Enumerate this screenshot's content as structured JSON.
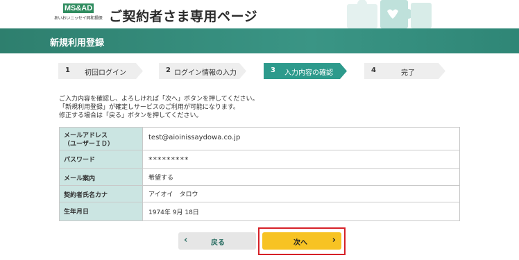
{
  "header": {
    "logo_text": "MS&AD",
    "logo_subtext": "あいおいニッセイ同和損保",
    "page_title": "ご契約者さま専用ページ"
  },
  "band": {
    "title": "新規利用登録"
  },
  "steps": [
    {
      "num": "1",
      "label": "初回ログイン"
    },
    {
      "num": "2",
      "label": "ログイン情報の入力"
    },
    {
      "num": "3",
      "label": "入力内容の確認"
    },
    {
      "num": "4",
      "label": "完了"
    }
  ],
  "instructions": [
    "ご入力内容を確認し、よろしければ「次へ」ボタンを押してください。",
    "「新規利用登録」が確定しサービスのご利用が可能になります。",
    "修正する場合は「戻る」ボタンを押してください。"
  ],
  "table": {
    "rows": [
      {
        "label_line1": "メールアドレス",
        "label_line2": "（ユーザーＩＤ）",
        "value": "test@aioinissaydowa.co.jp"
      },
      {
        "label": "パスワード",
        "value": "*********"
      },
      {
        "label": "メール案内",
        "value": "希望する"
      },
      {
        "label": "契約者氏名カナ",
        "value": "アイオイ　タロウ"
      },
      {
        "label": "生年月日",
        "value": "1974年 9月 18日"
      }
    ]
  },
  "buttons": {
    "back_label": "戻る",
    "next_label": "次へ"
  },
  "colors": {
    "brand_green": "#2e7f6e",
    "active_step": "#2d9a8c",
    "table_header": "#cbe5e2",
    "next_button": "#f7c323",
    "highlight_border": "#d62027"
  }
}
